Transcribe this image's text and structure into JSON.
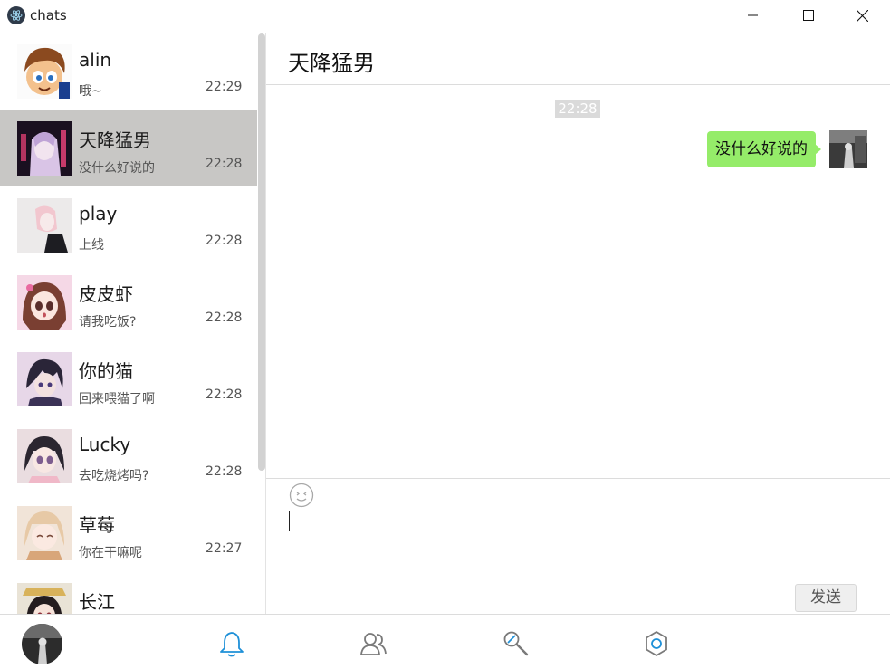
{
  "window": {
    "title": "chats"
  },
  "chats": [
    {
      "name": "alin",
      "preview": "哦~",
      "time": "22:29"
    },
    {
      "name": "天降猛男",
      "preview": "没什么好说的",
      "time": "22:28",
      "active": true
    },
    {
      "name": "play",
      "preview": "上线",
      "time": "22:28"
    },
    {
      "name": "皮皮虾",
      "preview": "请我吃饭?",
      "time": "22:28"
    },
    {
      "name": "你的猫",
      "preview": "回来喂猫了啊",
      "time": "22:28"
    },
    {
      "name": "Lucky",
      "preview": "去吃烧烤吗?",
      "time": "22:28"
    },
    {
      "name": "草莓",
      "preview": "你在干嘛呢",
      "time": "22:27"
    },
    {
      "name": "长江",
      "preview": "",
      "time": ""
    }
  ],
  "conversation": {
    "title": "天降猛男",
    "time_divider": "22:28",
    "messages": [
      {
        "text": "没什么好说的",
        "outgoing": true
      }
    ]
  },
  "composer": {
    "send_label": "发送",
    "emoji_icon": "smiley-icon"
  },
  "nav": {
    "icons": [
      "bell-icon",
      "contacts-icon",
      "search-icon",
      "settings-icon"
    ],
    "active": "bell-icon",
    "accent_color": "#1e90d8",
    "icon_color": "#7a7a7a"
  },
  "colors": {
    "active_item_bg": "#c8c7c5",
    "bubble_green": "#95ec69"
  }
}
